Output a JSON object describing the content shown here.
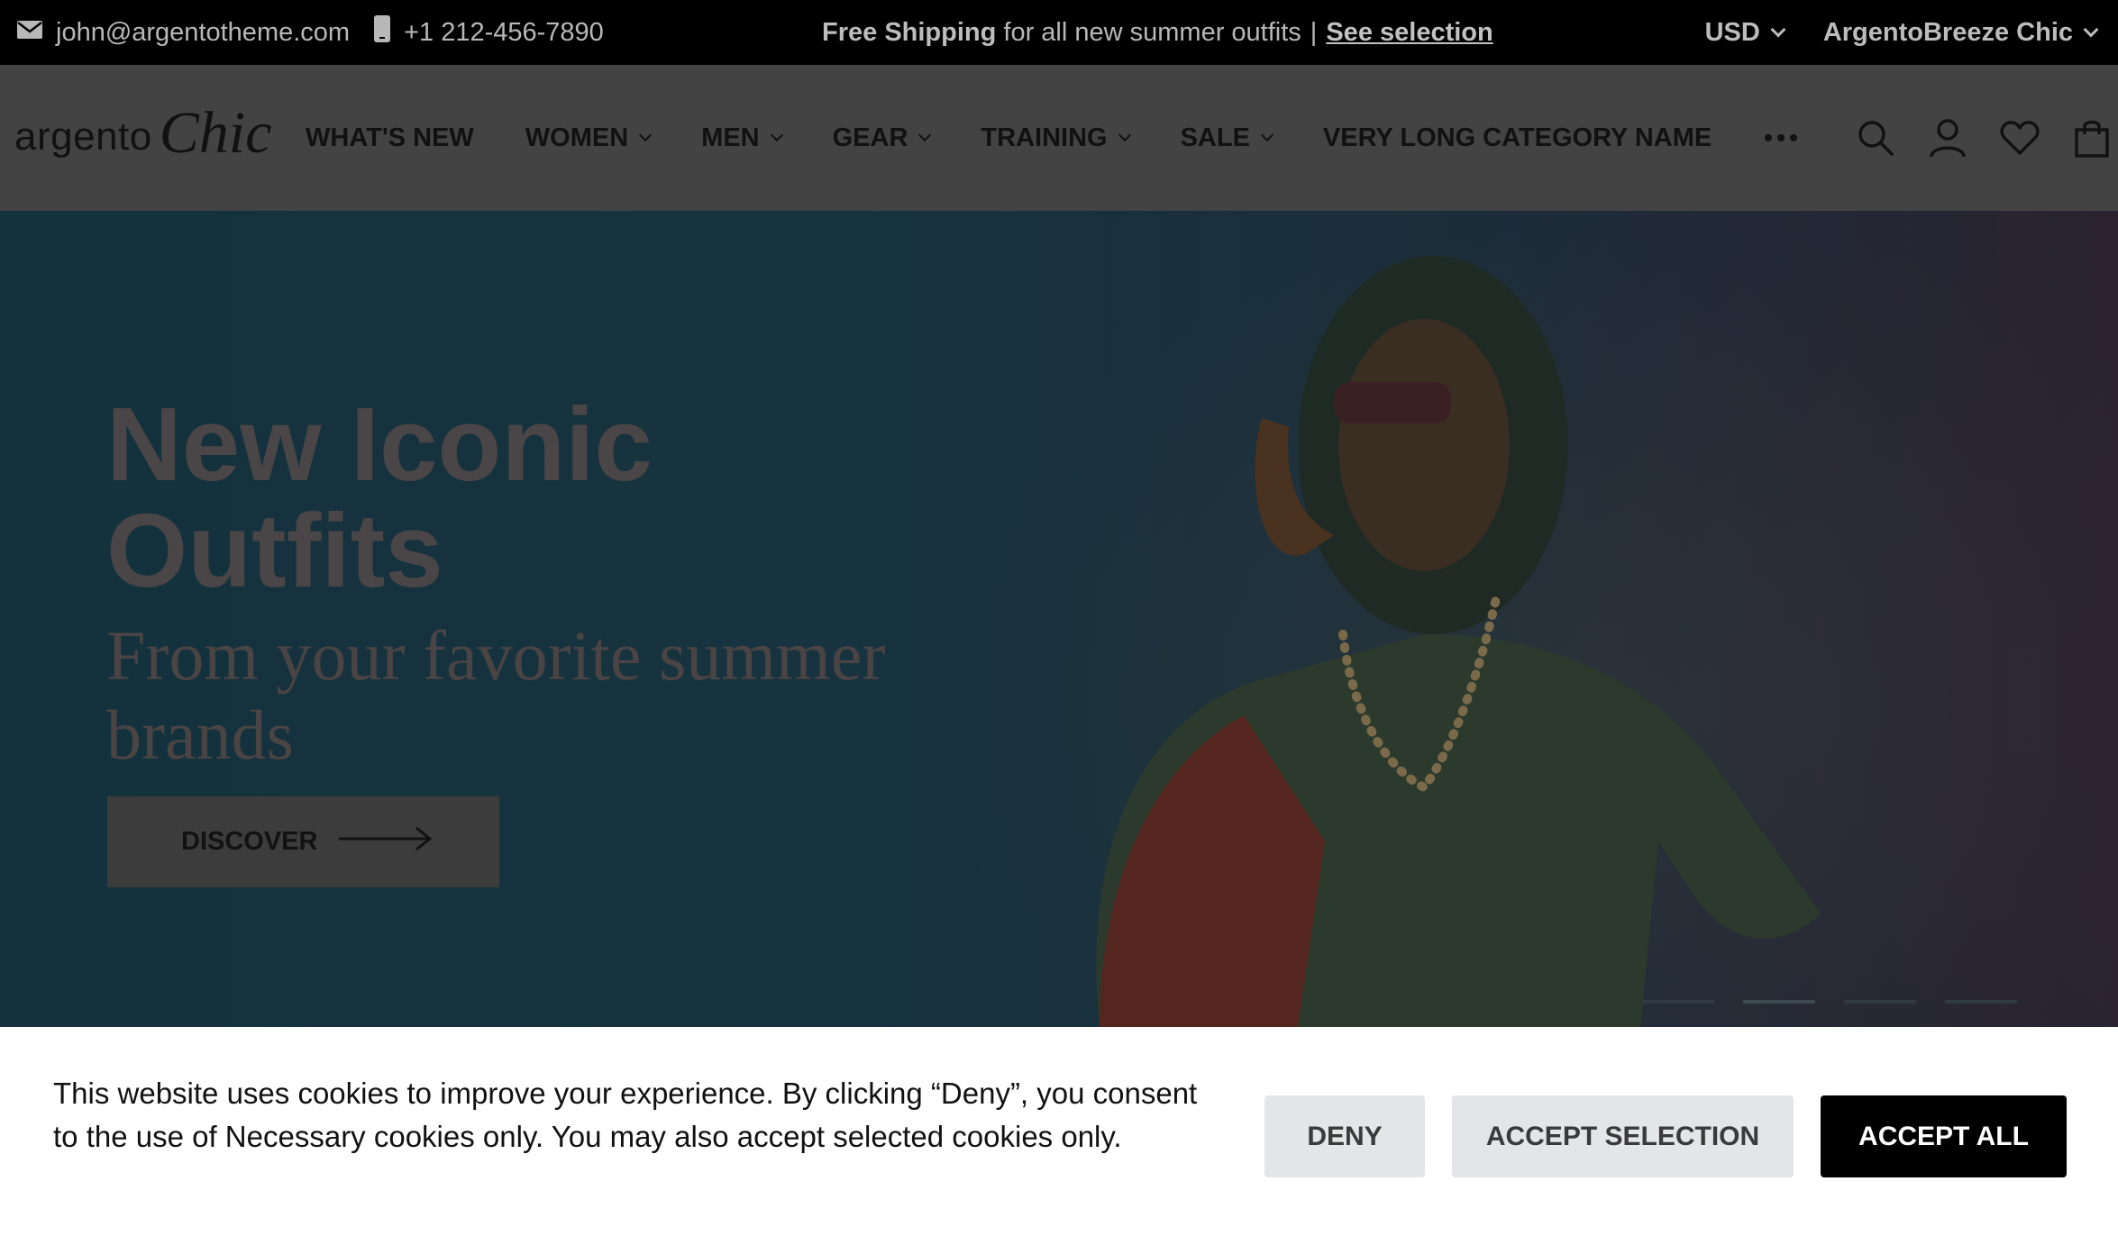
{
  "topbar": {
    "email": "john@argentotheme.com",
    "email_icon": "mail-icon",
    "phone": "+1 212-456-7890",
    "phone_icon": "phone-icon",
    "promo_bold": "Free Shipping",
    "promo_text": "for all new summer outfits",
    "promo_separator": "|",
    "promo_link": "See selection",
    "currency": "USD",
    "store": "ArgentoBreeze Chic"
  },
  "header": {
    "logo_part1": "argento",
    "logo_part2": "Chic",
    "nav": [
      {
        "label": "WHAT'S NEW",
        "has_dropdown": false
      },
      {
        "label": "WOMEN",
        "has_dropdown": true
      },
      {
        "label": "MEN",
        "has_dropdown": true
      },
      {
        "label": "GEAR",
        "has_dropdown": true
      },
      {
        "label": "TRAINING",
        "has_dropdown": true
      },
      {
        "label": "SALE",
        "has_dropdown": true
      },
      {
        "label": "VERY LONG CATEGORY NAME",
        "has_dropdown": false
      }
    ],
    "icons": [
      "search-icon",
      "account-icon",
      "wishlist-icon",
      "cart-icon"
    ]
  },
  "hero": {
    "title": "New Iconic Outfits",
    "subtitle": "From your favorite summer brands",
    "button": "DISCOVER",
    "slides": 4,
    "active_slide": 2
  },
  "cookie": {
    "text": "This website uses cookies to improve your experience. By clicking “Deny”, you consent to the use of Necessary cookies only. You may also accept selected cookies only.",
    "deny": "DENY",
    "accept_selection": "ACCEPT SELECTION",
    "accept_all": "ACCEPT ALL"
  },
  "colors": {
    "topbar_bg": "#000000",
    "header_bg": "#434343",
    "accept_all_bg": "#000000",
    "secondary_btn_bg": "#e4e5e9"
  }
}
